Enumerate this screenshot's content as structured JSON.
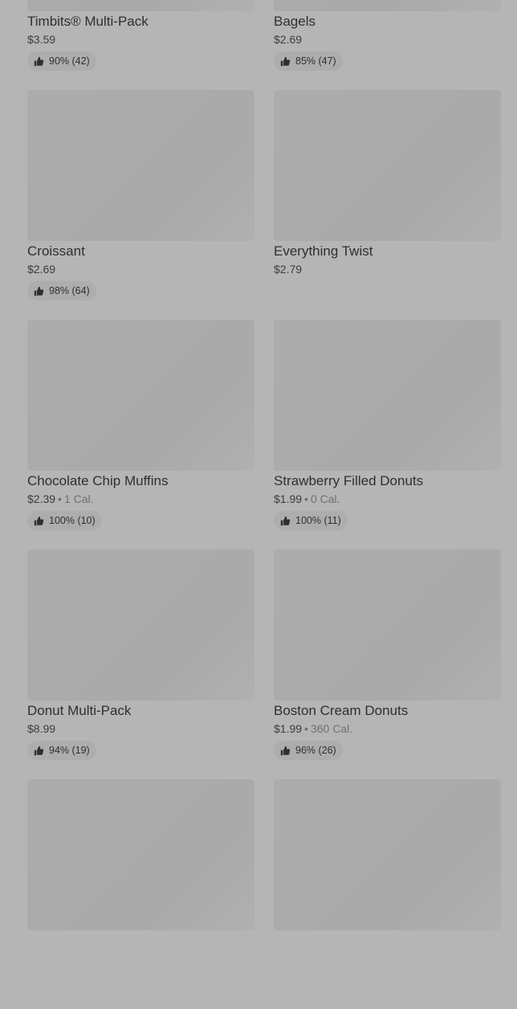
{
  "products": [
    {
      "name": "Timbits® Multi-Pack",
      "price": "$3.59",
      "calories": "",
      "rating": "90% (42)"
    },
    {
      "name": "Bagels",
      "price": "$2.69",
      "calories": "",
      "rating": "85% (47)"
    },
    {
      "name": "Croissant",
      "price": "$2.69",
      "calories": "",
      "rating": "98% (64)"
    },
    {
      "name": "Everything Twist",
      "price": "$2.79",
      "calories": "",
      "rating": ""
    },
    {
      "name": "Chocolate Chip Muffins",
      "price": "$2.39",
      "calories": "1 Cal.",
      "rating": "100% (10)"
    },
    {
      "name": "Strawberry Filled Donuts",
      "price": "$1.99",
      "calories": "0 Cal.",
      "rating": "100% (11)"
    },
    {
      "name": "Donut Multi-Pack",
      "price": "$8.99",
      "calories": "",
      "rating": "94% (19)"
    },
    {
      "name": "Boston Cream Donuts",
      "price": "$1.99",
      "calories": "360 Cal.",
      "rating": "96% (26)"
    },
    {
      "name": "",
      "price": "",
      "calories": "",
      "rating": ""
    },
    {
      "name": "",
      "price": "",
      "calories": "",
      "rating": ""
    }
  ],
  "separator": "•",
  "rating_icon": "thumbs-up-icon",
  "colors": {
    "background": "#b5b5b5",
    "thumbnail": "#ababab",
    "pill": "#adadad",
    "text": "#2f2f2f"
  }
}
